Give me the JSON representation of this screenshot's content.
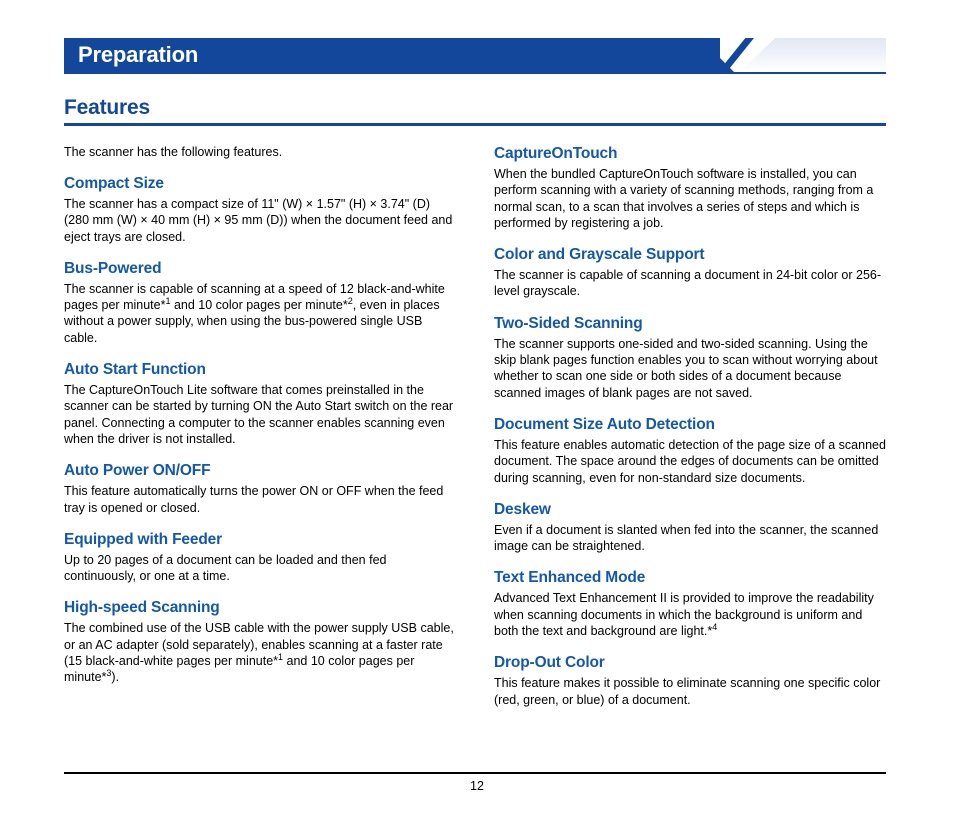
{
  "banner": {
    "chapter_title": "Preparation",
    "banner_color": "#13479B"
  },
  "section": {
    "title": "Features",
    "title_color": "#13479B",
    "heading_color": "#1458A8"
  },
  "intro": "The scanner has the following features.",
  "left_column": [
    {
      "heading": "Compact Size",
      "body": "The scanner has a compact size of 11\" (W) × 1.57\" (H) × 3.74\" (D) (280 mm (W) × 40 mm (H) × 95 mm (D)) when the document feed and eject trays are closed."
    },
    {
      "heading": "Bus-Powered",
      "body_part1": "The scanner is capable of scanning at a speed of 12 black-and-white pages per minute",
      "sup1": "1",
      "body_part2": " and 10 color pages per minute",
      "sup2": "2",
      "body_part3": ", even in places without a power supply, when using the bus-powered single USB cable."
    },
    {
      "heading": "Auto Start Function",
      "body": "The CaptureOnTouch Lite software that comes preinstalled in the scanner can be started by turning ON the Auto Start switch on the rear panel. Connecting a computer to the scanner enables scanning even when the driver is not installed."
    },
    {
      "heading": "Auto Power ON/OFF",
      "body": "This feature automatically turns the power ON or OFF when the feed tray is opened or closed."
    },
    {
      "heading": "Equipped with Feeder",
      "body": "Up to 20 pages of a document can be loaded and then fed continuously, or one at a time."
    },
    {
      "heading": "High-speed Scanning",
      "body_part1": "The combined use of the USB cable with the power supply USB cable, or an AC adapter (sold separately), enables scanning at a faster rate (15 black-and-white pages per minute",
      "sup1": "1",
      "body_part2": " and 10 color pages per minute",
      "sup2": "3",
      "body_part3": ")."
    }
  ],
  "right_column": [
    {
      "heading": "CaptureOnTouch",
      "body": "When the bundled CaptureOnTouch software is installed, you can perform scanning with a variety of scanning methods, ranging from a normal scan, to a scan that involves a series of steps and which is performed by registering a job."
    },
    {
      "heading": "Color and Grayscale Support",
      "body": "The scanner is capable of scanning a document in 24-bit color or 256-level grayscale."
    },
    {
      "heading": "Two-Sided Scanning",
      "body": "The scanner supports one-sided and two-sided scanning. Using the skip blank pages function enables you to scan without worrying about whether to scan one side or both sides of a document because scanned images of blank pages are not saved."
    },
    {
      "heading": "Document Size Auto Detection",
      "body": "This feature enables automatic detection of the page size of a scanned document. The space around the edges of documents can be omitted during scanning, even for non-standard size documents."
    },
    {
      "heading": "Deskew",
      "body": "Even if a document is slanted when fed into the scanner, the scanned image can be straightened."
    },
    {
      "heading": "Text Enhanced Mode",
      "body_part1": "Advanced Text Enhancement II is provided to improve the readability when scanning documents in which the background is uniform and both the text and background are light.",
      "sup1": "4",
      "body_part2": ""
    },
    {
      "heading": "Drop-Out Color",
      "body": "This feature makes it possible to eliminate scanning one specific color (red, green, or blue) of a document."
    }
  ],
  "footer": {
    "page_number": "12"
  }
}
